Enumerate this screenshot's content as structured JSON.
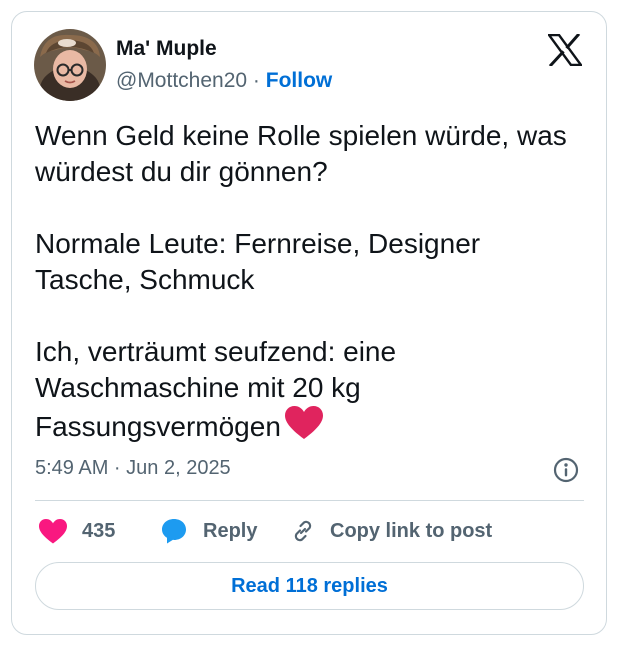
{
  "author": {
    "name": "Ma' Muple",
    "handle": "@Mottchen20",
    "separator": "·",
    "follow_label": "Follow",
    "avatar_icon": "profile-photo"
  },
  "brand": {
    "logo_icon": "x-logo-icon"
  },
  "tweet": {
    "paragraphs": [
      "Wenn Geld keine Rolle spielen würde, was würdest du dir gönnen?",
      "Normale Leute: Fernreise, Designer Tasche, Schmuck",
      "Ich, verträumt seufzend: eine Waschmaschine mit 20 kg Fassungsvermögen"
    ],
    "emoji": "red-heart",
    "timestamp": "5:49 AM · Jun 2, 2025"
  },
  "actions": {
    "like_count": "435",
    "reply_label": "Reply",
    "copy_link_label": "Copy link to post"
  },
  "read_replies_label": "Read 118 replies",
  "colors": {
    "text_primary": "#0f1419",
    "text_secondary": "#536471",
    "link_blue": "#006fd6",
    "like_pink": "#f91880",
    "reply_blue": "#1d9bf0",
    "heart_red": "#e0245e",
    "border": "#cfd9de"
  }
}
